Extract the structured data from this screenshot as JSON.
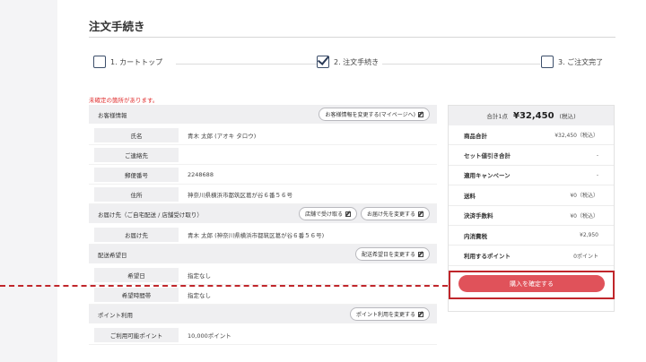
{
  "page": {
    "title": "注文手続き",
    "warning": "未確定の箇所があります。"
  },
  "steps": [
    {
      "label": "1. カートトップ",
      "checked": false
    },
    {
      "label": "2. 注文手続き",
      "checked": true
    },
    {
      "label": "3. ご注文完了",
      "checked": false
    }
  ],
  "customer": {
    "title": "お客様情報",
    "change_button": "お客様情報を変更する(マイページへ)",
    "rows": [
      {
        "label": "氏名",
        "value": "青木 太郎 (アオキ タロウ)"
      },
      {
        "label": "ご連絡先",
        "value": ""
      },
      {
        "label": "郵便番号",
        "value": "2248688"
      },
      {
        "label": "住所",
        "value": "神奈川県横浜市都筑区葛が谷６番５６号"
      }
    ]
  },
  "delivery": {
    "title": "お届け先（ご自宅配送 / 店舗受け取り）",
    "store_button": "店舗で受け取る",
    "change_button": "お届け先を変更する",
    "rows": [
      {
        "label": "お届け先",
        "value": "青木 太郎 (神奈川県横浜市都筑区葛が谷６番５６号)"
      }
    ]
  },
  "schedule": {
    "title": "配送希望日",
    "change_button": "配送希望日を変更する",
    "rows": [
      {
        "label": "希望日",
        "value": "指定なし"
      },
      {
        "label": "希望時間帯",
        "value": "指定なし"
      }
    ]
  },
  "points": {
    "title": "ポイント利用",
    "change_button": "ポイント利用を変更する",
    "rows": [
      {
        "label": "ご利用可能ポイント",
        "value": "10,000ポイント"
      }
    ]
  },
  "summary": {
    "count": "合計1点",
    "total": "¥32,450",
    "tax": "(税込)",
    "rows": [
      {
        "label": "商品合計",
        "value": "¥32,450（税込）"
      },
      {
        "label": "セット値引き合計",
        "value": "-"
      },
      {
        "label": "適用キャンペーン",
        "value": "-"
      },
      {
        "label": "送料",
        "value": "¥0（税込）"
      },
      {
        "label": "決済手数料",
        "value": "¥0（税込）"
      },
      {
        "label": "内消費税",
        "value": "¥2,950"
      },
      {
        "label": "利用するポイント",
        "value": "0ポイント"
      }
    ],
    "confirm_button": "購入を確定する"
  },
  "colors": {
    "accent": "#e0525a",
    "highlight": "#c0262b",
    "step_check": "#2a3a57"
  },
  "icons": [
    "checkbox-icon",
    "checkmark-icon",
    "edit-icon"
  ]
}
